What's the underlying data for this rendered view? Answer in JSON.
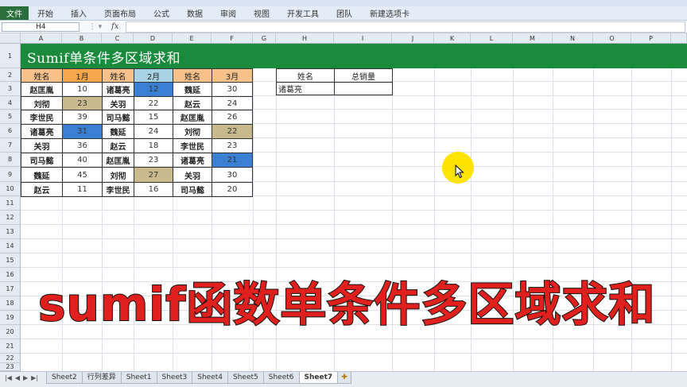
{
  "ribbon": {
    "file_tab": "文件",
    "tabs": [
      "开始",
      "插入",
      "页面布局",
      "公式",
      "数据",
      "审阅",
      "视图",
      "开发工具",
      "团队",
      "新建选项卡"
    ]
  },
  "formula_bar": {
    "name_box": "H4",
    "fx": "fx",
    "formula": ""
  },
  "columns": [
    "A",
    "B",
    "C",
    "D",
    "E",
    "F",
    "G",
    "H",
    "I",
    "J",
    "K",
    "L",
    "M",
    "N",
    "O",
    "P"
  ],
  "rows": [
    "1",
    "2",
    "3",
    "4",
    "5",
    "6",
    "7",
    "8",
    "9",
    "10",
    "11",
    "12",
    "13",
    "14",
    "15",
    "16",
    "17",
    "18",
    "19",
    "20",
    "21",
    "22",
    "23"
  ],
  "sheet_title": "Sumif单条件多区域求和",
  "table": {
    "headers": [
      "姓名",
      "1月",
      "姓名",
      "2月",
      "姓名",
      "3月"
    ],
    "rows": [
      [
        "赵匡胤",
        "10",
        "诸葛亮",
        "12",
        "魏延",
        "30"
      ],
      [
        "刘彻",
        "23",
        "关羽",
        "22",
        "赵云",
        "24"
      ],
      [
        "李世民",
        "39",
        "司马懿",
        "15",
        "赵匡胤",
        "26"
      ],
      [
        "诸葛亮",
        "31",
        "魏延",
        "24",
        "刘彻",
        "22"
      ],
      [
        "关羽",
        "36",
        "赵云",
        "18",
        "李世民",
        "23"
      ],
      [
        "司马懿",
        "40",
        "赵匡胤",
        "23",
        "诸葛亮",
        "21"
      ],
      [
        "魏延",
        "45",
        "刘彻",
        "27",
        "关羽",
        "30"
      ],
      [
        "赵云",
        "11",
        "李世民",
        "16",
        "司马懿",
        "20"
      ]
    ]
  },
  "lookup": {
    "header_name": "姓名",
    "header_total": "总销量",
    "name_value": "诸葛亮",
    "total_value": ""
  },
  "caption": "sumif函数单条件多区域求和",
  "sheet_tabs": [
    "Sheet2",
    "行列差异",
    "Sheet1",
    "Sheet3",
    "Sheet4",
    "Sheet5",
    "Sheet6",
    "Sheet7"
  ],
  "active_sheet": "Sheet7",
  "colors": {
    "title_band": "#1a8a3c",
    "highlight_tan": "#c9b98d",
    "highlight_blue": "#3a7fd1",
    "caption_red": "#e0201c",
    "cursor_halo": "#ffe400"
  }
}
